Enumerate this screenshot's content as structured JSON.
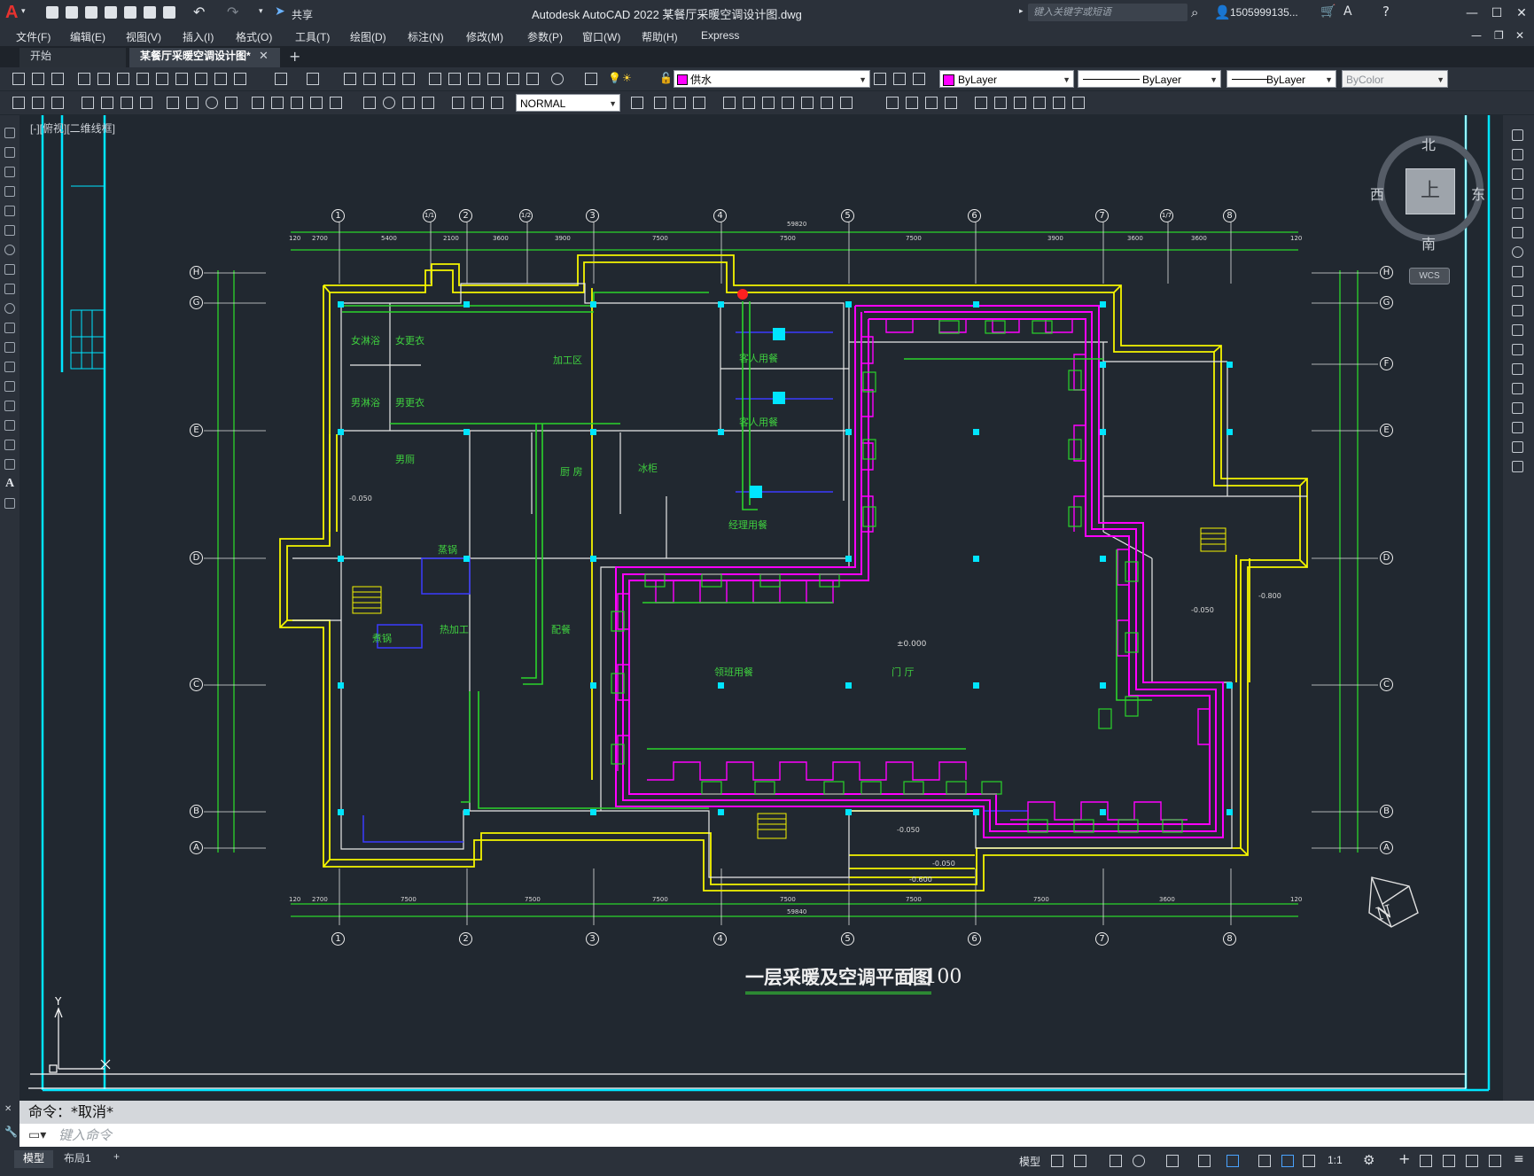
{
  "title_bar": {
    "share_label": "共享",
    "app_title": "Autodesk AutoCAD 2022    某餐厅采暖空调设计图.dwg",
    "search_placeholder": "键入关键字或短语",
    "user_name": "1505999135...",
    "minimize": "—",
    "restore": "☐",
    "close": "✕"
  },
  "menu": [
    "文件(F)",
    "编辑(E)",
    "视图(V)",
    "插入(I)",
    "格式(O)",
    "工具(T)",
    "绘图(D)",
    "标注(N)",
    "修改(M)",
    "参数(P)",
    "窗口(W)",
    "帮助(H)",
    "Express"
  ],
  "tabs": {
    "start": "开始",
    "drawing": "某餐厅采暖空调设计图*",
    "add": "+"
  },
  "properties": {
    "layer": "供水",
    "color": "ByLayer",
    "linetype": "ByLayer",
    "lineweight": "ByLayer",
    "plotstyle": "ByColor",
    "textstyle": "NORMAL"
  },
  "viewport_label": "[-][俯视][二维线框]",
  "viewcube": {
    "north": "北",
    "south": "南",
    "west": "西",
    "east": "东",
    "top": "上",
    "wcs": "WCS"
  },
  "drawing": {
    "title": "一层采暖及空调平面图",
    "scale": "1:100",
    "grid_top": [
      "1",
      "1/1",
      "2",
      "1/2",
      "3",
      "4",
      "5",
      "6",
      "7",
      "1/7",
      "8"
    ],
    "grid_bottom": [
      "1",
      "2",
      "3",
      "4",
      "5",
      "6",
      "7",
      "8"
    ],
    "grid_left": [
      "H",
      "G",
      "E",
      "D",
      "C",
      "B",
      "A"
    ],
    "grid_right": [
      "H",
      "G",
      "F",
      "E",
      "D",
      "C",
      "B",
      "A"
    ],
    "overall_dim_top": "59820",
    "overall_dim_bottom": "59840",
    "top_dims": [
      "120",
      "2700",
      "5400",
      "2100",
      "3600",
      "3900",
      "7500",
      "7500",
      "7500",
      "3900",
      "3600",
      "3600",
      "120"
    ],
    "bottom_dims": [
      "120",
      "2700",
      "7500",
      "7500",
      "7500",
      "7500",
      "7500",
      "7500",
      "3600",
      "120"
    ],
    "rooms": [
      "女淋浴",
      "女更衣",
      "男淋浴",
      "男更衣",
      "男厕",
      "加工区",
      "客人用餐",
      "客人用餐",
      "厨  房",
      "冰柜",
      "经理用餐",
      "蒸锅",
      "热加工",
      "煮锅",
      "配餐",
      "领班用餐",
      "门  厅"
    ],
    "levels": [
      "±0.000",
      "-0.050",
      "-0.050",
      "-0.050",
      "-0.050",
      "-0.600",
      "-0.800"
    ]
  },
  "command": {
    "history": "命令：*取消*",
    "placeholder": "键入命令"
  },
  "status": {
    "model_tab": "模型",
    "layout_tab": "布局1",
    "add_layout": "+",
    "model_space": "模型",
    "scale": "1:1"
  },
  "colors": {
    "accent_cyan": "#00e5ff",
    "wall_yellow": "#f5f500",
    "supply_magenta": "#ff00ff",
    "duct_green": "#2bd42b",
    "alert_red": "#ff2020"
  }
}
